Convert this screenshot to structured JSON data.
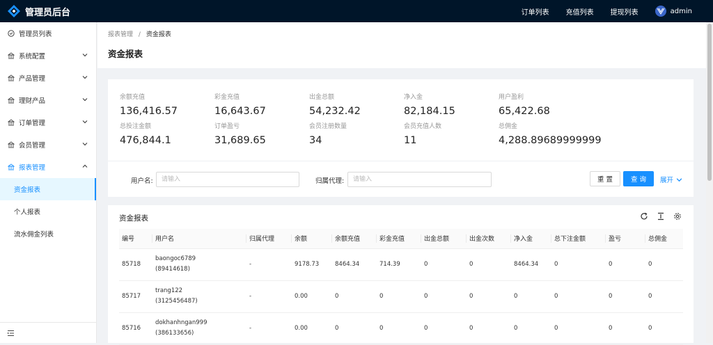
{
  "app": {
    "title": "管理员后台"
  },
  "topnav": {
    "orders": "订单列表",
    "recharges": "充值列表",
    "withdrawals": "提现列表",
    "username": "admin"
  },
  "sidebar": {
    "items": [
      {
        "label": "管理员列表",
        "icon": "clock-icon"
      },
      {
        "label": "系统配置",
        "icon": "bank-icon"
      },
      {
        "label": "产品管理",
        "icon": "bank-icon"
      },
      {
        "label": "理财产品",
        "icon": "bank-icon"
      },
      {
        "label": "订单管理",
        "icon": "bank-icon"
      },
      {
        "label": "会员管理",
        "icon": "bank-icon"
      },
      {
        "label": "报表管理",
        "icon": "bank-icon"
      }
    ],
    "subitems": [
      "资金报表",
      "个人报表",
      "流水佣金列表"
    ]
  },
  "breadcrumb": {
    "parent": "报表管理",
    "separator": "/",
    "current": "资金报表"
  },
  "page": {
    "title": "资金报表"
  },
  "stats": [
    {
      "label": "余额充值",
      "value": "136,416.57"
    },
    {
      "label": "彩金充值",
      "value": "16,643.67"
    },
    {
      "label": "出金总额",
      "value": "54,232.42"
    },
    {
      "label": "净入金",
      "value": "82,184.15"
    },
    {
      "label": "用户盈利",
      "value": "65,422.68"
    },
    {
      "label": "总投注金额",
      "value": "476,844.1"
    },
    {
      "label": "订单盈亏",
      "value": "31,689.65"
    },
    {
      "label": "会员注册数量",
      "value": "34"
    },
    {
      "label": "会员充值人数",
      "value": "11"
    },
    {
      "label": "总佣金",
      "value": "4,288.89689999999"
    }
  ],
  "filters": {
    "username_label": "用户名:",
    "username_placeholder": "请输入",
    "agent_label": "归属代理:",
    "agent_placeholder": "请输入",
    "reset": "重 置",
    "query": "查 询",
    "expand": "展开"
  },
  "table": {
    "title": "资金报表",
    "columns": [
      "编号",
      "用户名",
      "归属代理",
      "余额",
      "余额充值",
      "彩金充值",
      "出金总额",
      "出金次数",
      "净入金",
      "总下注金额",
      "盈亏",
      "总佣金"
    ],
    "rows": [
      {
        "id": "85718",
        "user": "baongoc6789",
        "uid": "(89414618)",
        "agent": "-",
        "balance": "9178.73",
        "recharge": "8464.34",
        "bonus": "714.39",
        "out_total": "0",
        "out_count": "0",
        "net": "8464.34",
        "bet": "0",
        "pnl": "0",
        "commission": "0"
      },
      {
        "id": "85717",
        "user": "trang122",
        "uid": "(3125456487)",
        "agent": "-",
        "balance": "0.00",
        "recharge": "0",
        "bonus": "0",
        "out_total": "0",
        "out_count": "0",
        "net": "0",
        "bet": "0",
        "pnl": "0",
        "commission": "0"
      },
      {
        "id": "85716",
        "user": "dokhanhngan999",
        "uid": "(386133656)",
        "agent": "-",
        "balance": "0.00",
        "recharge": "0",
        "bonus": "0",
        "out_total": "0",
        "out_count": "0",
        "net": "0",
        "bet": "0",
        "pnl": "0",
        "commission": "0"
      }
    ]
  },
  "colors": {
    "primary": "#1890ff",
    "header": "#001529"
  }
}
